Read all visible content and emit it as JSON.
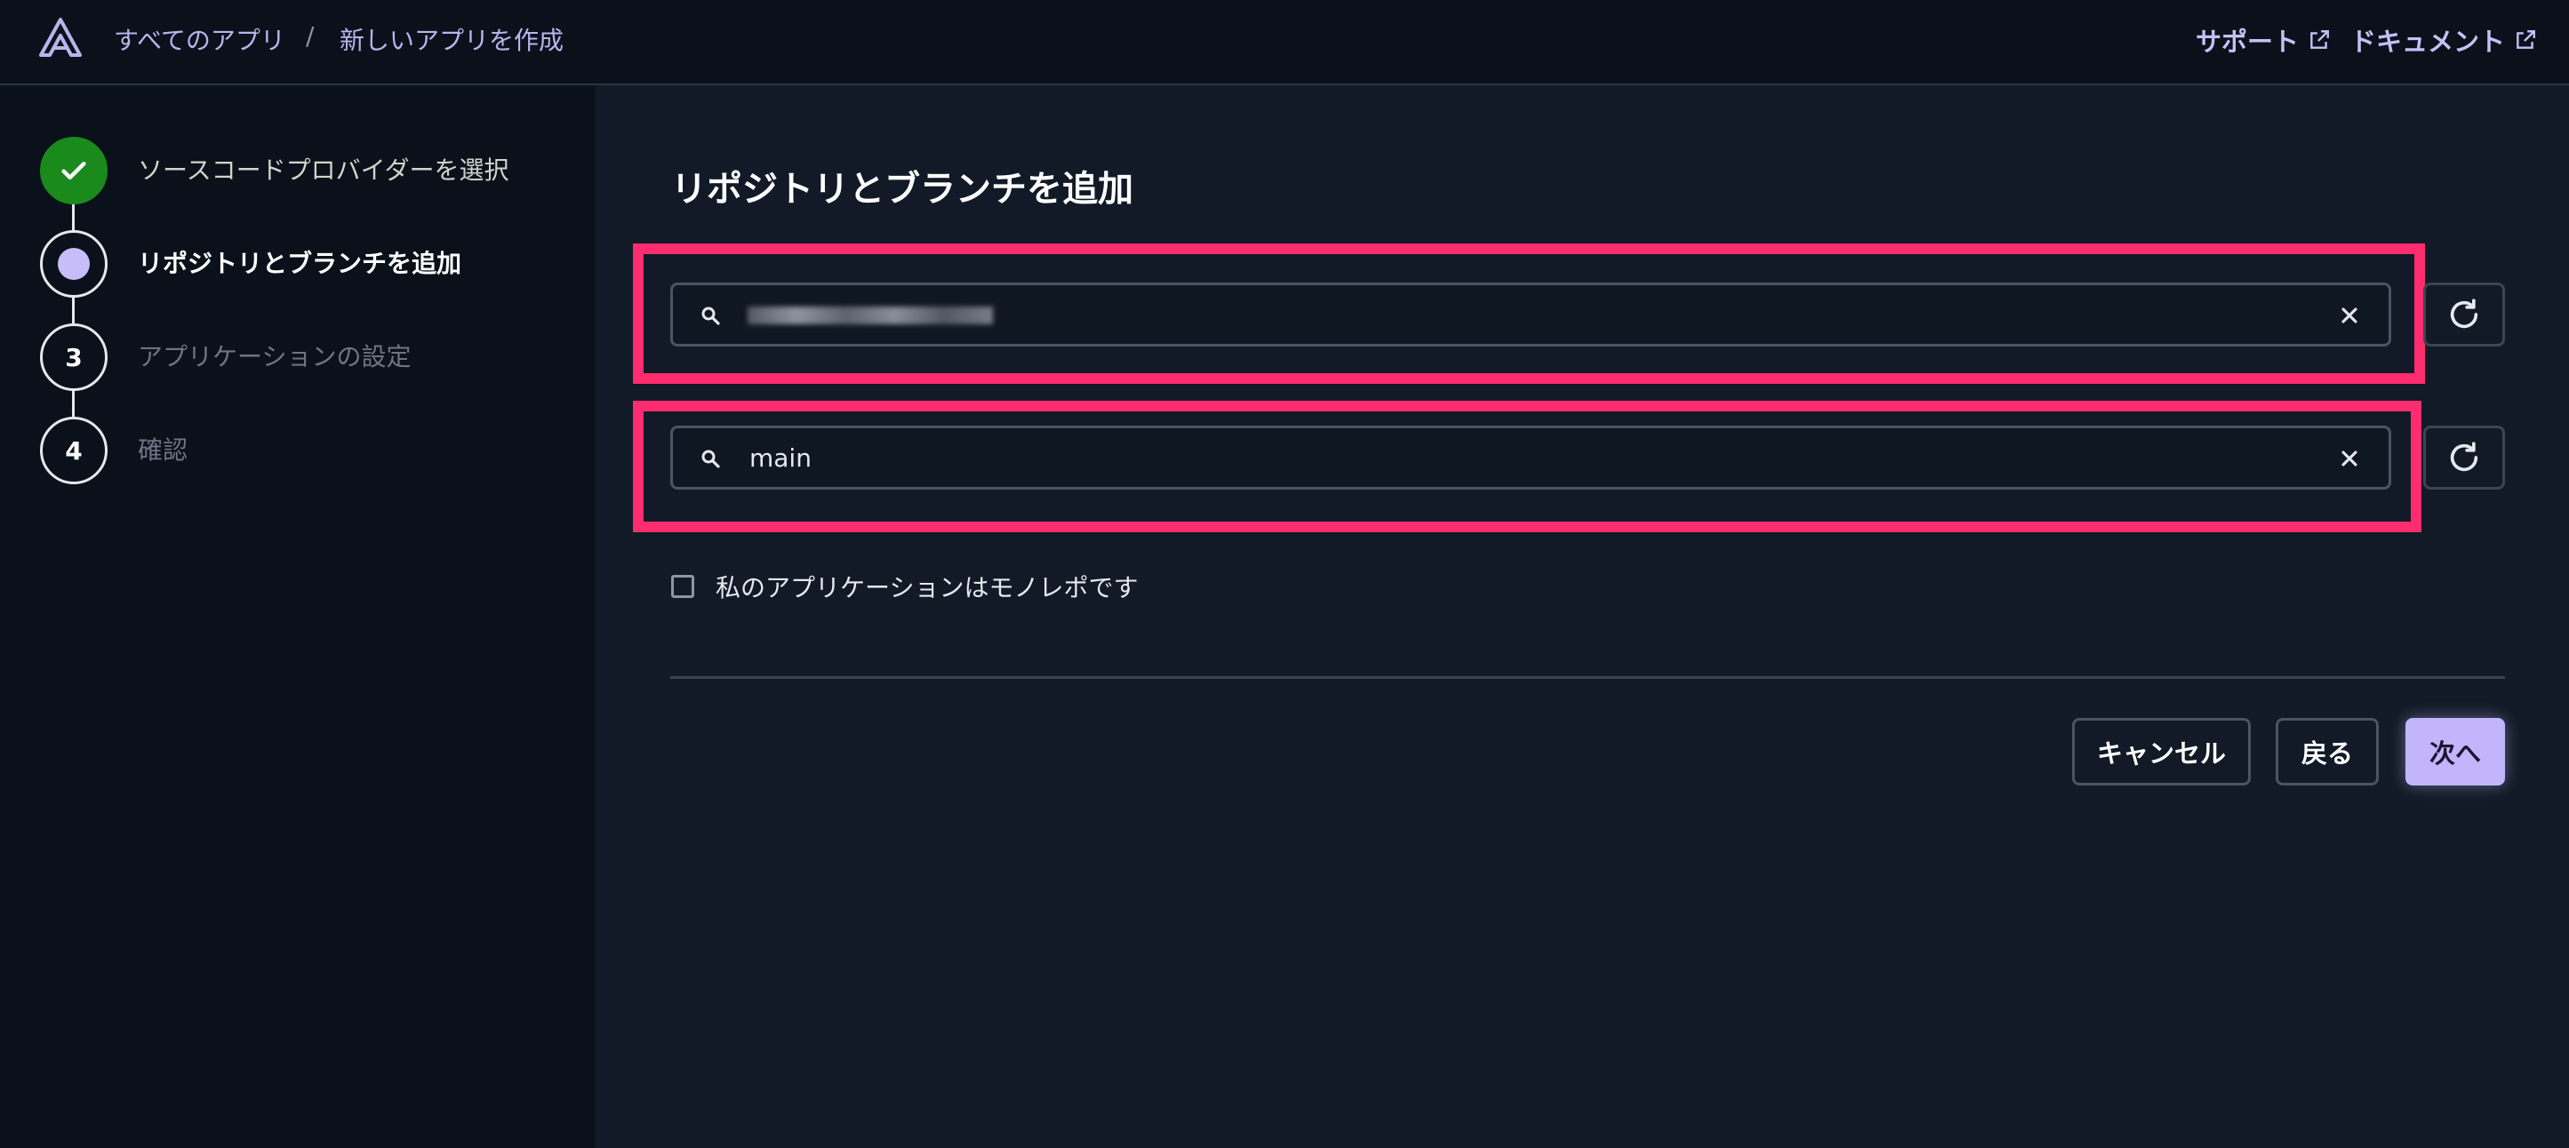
{
  "header": {
    "breadcrumb": [
      "すべてのアプリ",
      "新しいアプリを作成"
    ],
    "breadcrumb_separator": "/",
    "links": [
      {
        "label": "サポート",
        "icon": "external-link-icon"
      },
      {
        "label": "ドキュメント",
        "icon": "external-link-icon"
      }
    ]
  },
  "steps": [
    {
      "number": "",
      "label": "ソースコードプロバイダーを選択",
      "status": "done"
    },
    {
      "number": "",
      "label": "リポジトリとブランチを追加",
      "status": "active"
    },
    {
      "number": "3",
      "label": "アプリケーションの設定",
      "status": "todo"
    },
    {
      "number": "4",
      "label": "確認",
      "status": "todo"
    }
  ],
  "main": {
    "title": "リポジトリとブランチを追加",
    "repository_field": {
      "value": "",
      "redacted": true
    },
    "branch_field": {
      "value": "main"
    },
    "monorepo_checkbox": {
      "label": "私のアプリケーションはモノレポです",
      "checked": false
    }
  },
  "actions": {
    "cancel": "キャンセル",
    "back": "戻る",
    "next": "次へ"
  },
  "colors": {
    "accent": "#c3b5fb",
    "highlight": "#ff2d6f",
    "success": "#1a8a1d",
    "background": "#111a26",
    "sidebar": "#0b111b"
  }
}
